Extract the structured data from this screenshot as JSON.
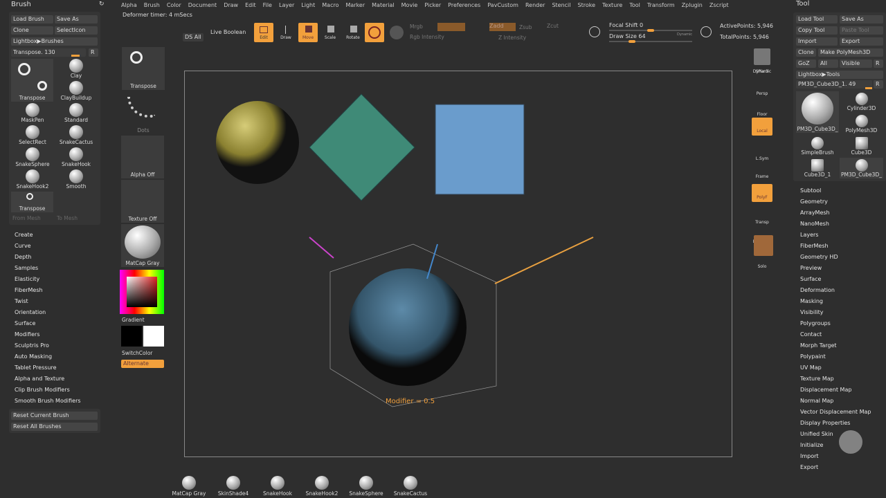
{
  "menu": [
    "Alpha",
    "Brush",
    "Color",
    "Document",
    "Draw",
    "Edit",
    "File",
    "Layer",
    "Light",
    "Macro",
    "Marker",
    "Material",
    "Movie",
    "Picker",
    "Preferences",
    "PavCustom",
    "Render",
    "Stencil",
    "Stroke",
    "Texture",
    "Tool",
    "Transform",
    "Zplugin",
    "Zscript"
  ],
  "status": "Deformer timer: 4 mSecs",
  "toolbar": {
    "ds_all": "DS All",
    "live_boolean": "Live Boolean",
    "edit": "Edit",
    "draw": "Draw",
    "move": "Move",
    "scale": "Scale",
    "rotate": "Rotate",
    "mrgb": "Mrgb",
    "rgb_intensity": "Rgb Intensity",
    "zadd": "Zadd",
    "zsub": "Zsub",
    "zcut": "Zcut",
    "z_intensity": "Z Intensity",
    "focal_shift": "Focal Shift 0",
    "draw_size": "Draw Size 64",
    "dynamic": "Dynamic",
    "active_points": "ActivePoints: 5,946",
    "total_points": "TotalPoints: 5,946"
  },
  "brush": {
    "title": "Brush",
    "buttons": [
      "Load Brush",
      "Save As",
      "Clone",
      "SelectIcon",
      "Lightbox▶Brushes"
    ],
    "slider": "Transpose. 130",
    "r": "R",
    "current": "Transpose",
    "items": [
      "Clay",
      "ClayBuildup",
      "MaskPen",
      "Standard",
      "SelectRect",
      "SnakeCactus",
      "SnakeSphere",
      "SnakeHook",
      "SnakeHook2",
      "Smooth"
    ],
    "bottom": "Transpose",
    "from_mesh": "From Mesh",
    "to_mesh": "To Mesh",
    "sections": [
      "Create",
      "Curve",
      "Depth",
      "Samples",
      "Elasticity",
      "FiberMesh",
      "Twist",
      "Orientation",
      "Surface",
      "Modifiers",
      "Sculptris Pro",
      "Auto Masking",
      "Tablet Pressure",
      "Alpha and Texture",
      "Clip Brush Modifiers",
      "Smooth Brush Modifiers"
    ],
    "reset_current": "Reset Current Brush",
    "reset_all": "Reset All Brushes"
  },
  "leftshelf": {
    "transpose": "Transpose",
    "dots": "Dots",
    "alpha": "Alpha Off",
    "texture": "Texture Off",
    "material": "MatCap Gray",
    "gradient": "Gradient",
    "switch": "SwitchColor",
    "alternate": "Alternate"
  },
  "viewport": {
    "modifier": "Modifier = 0.5"
  },
  "rightshelf": [
    "SPix 3",
    "Dynamic",
    "Persp",
    "Floor",
    "Local",
    "L.Sym",
    "Frame",
    "PolyF",
    "Transp",
    "Dynamic",
    "Solo"
  ],
  "tool": {
    "title": "Tool",
    "buttons": [
      "Load Tool",
      "Save As",
      "Copy Tool",
      "Paste Tool",
      "Import",
      "Export",
      "Clone",
      "Make PolyMesh3D",
      "GoZ",
      "All",
      "Visible",
      "R",
      "Lightbox▶Tools"
    ],
    "slider": "PM3D_Cube3D_1. 49",
    "r": "R",
    "items": [
      "PM3D_Cube3D_",
      "Cylinder3D",
      "PolyMesh3D",
      "SimpleBrush",
      "Cube3D",
      "Cube3D_1",
      "PM3D_Cube3D_"
    ],
    "sections": [
      "Subtool",
      "Geometry",
      "ArrayMesh",
      "NanoMesh",
      "Layers",
      "FiberMesh",
      "Geometry HD",
      "Preview",
      "Surface",
      "Deformation",
      "Masking",
      "Visibility",
      "Polygroups",
      "Contact",
      "Morph Target",
      "Polypaint",
      "UV Map",
      "Texture Map",
      "Displacement Map",
      "Normal Map",
      "Vector Displacement Map",
      "Display Properties",
      "Unified Skin",
      "Initialize",
      "Import",
      "Export"
    ]
  },
  "bottomshelf": [
    "MatCap Gray",
    "SkinShade4",
    "SnakeHook",
    "SnakeHook2",
    "SnakeSphere",
    "SnakeCactus"
  ],
  "colors": {
    "accent": "#f2a03c",
    "bg": "#2e2e2e",
    "panel": "#353535"
  }
}
